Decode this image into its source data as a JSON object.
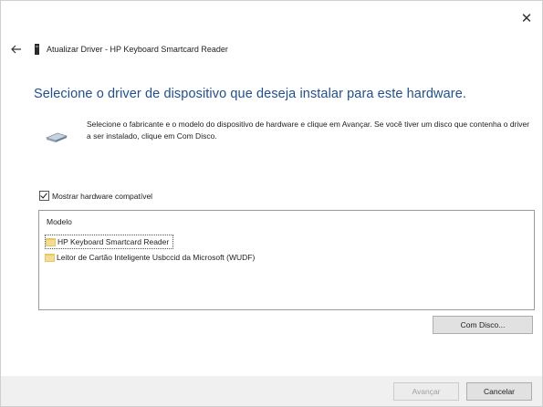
{
  "window": {
    "close_label": "✕",
    "title": "Atualizar Driver - HP Keyboard Smartcard Reader"
  },
  "heading": "Selecione o driver de dispositivo que deseja instalar para este hardware.",
  "description": "Selecione o fabricante e o modelo do dispositivo de hardware e clique em Avançar. Se você tiver um disco que contenha o driver a ser instalado, clique em Com Disco.",
  "compat_checkbox": {
    "label": "Mostrar hardware compatível",
    "checked": true
  },
  "model_list": {
    "header": "Modelo",
    "items": [
      {
        "label": "HP Keyboard Smartcard Reader",
        "selected": true
      },
      {
        "label": "Leitor de Cartão Inteligente Usbccid da Microsoft (WUDF)",
        "selected": false
      }
    ]
  },
  "buttons": {
    "have_disk": "Com Disco...",
    "next": "Avançar",
    "cancel": "Cancelar"
  },
  "colors": {
    "heading": "#1f4e96",
    "footer_bg": "#f0f0f0"
  },
  "icons": [
    "close-icon",
    "back-arrow-icon",
    "device-icon",
    "hardware-icon",
    "driver-icon"
  ]
}
